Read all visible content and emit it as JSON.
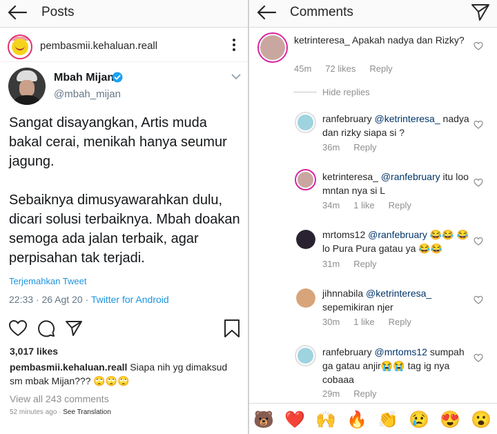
{
  "left": {
    "topbar": {
      "title": "Posts"
    },
    "post": {
      "username": "pembasmii.kehaluan.reall"
    },
    "tweet": {
      "name": "Mbah Mijan",
      "handle": "@mbah_mijan",
      "body": "Sangat disayangkan, Artis muda bakal cerai, menikah hanya seumur jagung.\n\nSebaiknya dimusyawarahkan dulu, dicari solusi terbaiknya. Mbah doakan semoga ada jalan terbaik, agar perpisahan tak terjadi.",
      "translate": "Terjemahkan Tweet",
      "time": "22:33 · 26 Agt 20 · ",
      "via": "Twitter for Android"
    },
    "likes": "3,017 likes",
    "caption": {
      "user": "pembasmii.kehaluan.reall",
      "text": " Siapa nih yg dimaksud sm mbak Mijan??? 🙄🙄🙄"
    },
    "view_all": "View all 243 comments",
    "time_ago": "52 minutes ago · ",
    "see_translation": "See Translation"
  },
  "right": {
    "topbar": {
      "title": "Comments"
    },
    "hide_replies": "Hide replies",
    "comments": [
      {
        "user": "ketrinteresa_",
        "mention": "",
        "text": " Apakah nadya dan Rizky?",
        "time": "45m",
        "likes": "72 likes",
        "reply": "Reply",
        "avatar_color": "#c9a7a0"
      },
      {
        "user": "ranfebruary",
        "mention": " @ketrinteresa_",
        "text": " nadya dan rizky siapa si ?",
        "time": "36m",
        "likes": "",
        "reply": "Reply",
        "avatar_color": "#9fd3e0"
      },
      {
        "user": "ketrinteresa_",
        "mention": " @ranfebruary",
        "text": " itu loo mntan nya si L",
        "time": "34m",
        "likes": "1 like",
        "reply": "Reply",
        "avatar_color": "#c9a7a0"
      },
      {
        "user": "mrtoms12",
        "mention": " @ranfebruary",
        "text": " 😂😂 😂lo Pura Pura gatau ya 😂😂",
        "time": "31m",
        "likes": "",
        "reply": "Reply",
        "avatar_color": "#2a2230"
      },
      {
        "user": "jihnnabila",
        "mention": " @ketrinteresa_",
        "text": " sepemikiran njer",
        "time": "30m",
        "likes": "1 like",
        "reply": "Reply",
        "avatar_color": "#d8a47a"
      },
      {
        "user": "ranfebruary",
        "mention": " @mrtoms12",
        "text": " sumpah ga gatau anjir😭😭 tag ig nya cobaaa",
        "time": "29m",
        "likes": "",
        "reply": "Reply",
        "avatar_color": "#9fd3e0"
      }
    ],
    "emoji_bar": [
      "🐻",
      "❤️",
      "🙌",
      "🔥",
      "👏",
      "😢",
      "😍",
      "😮"
    ]
  },
  "colors": {
    "link": "#1b95e0",
    "muted": "#8e8e8e",
    "mention": "#003569",
    "verified": "#1da1f2"
  }
}
